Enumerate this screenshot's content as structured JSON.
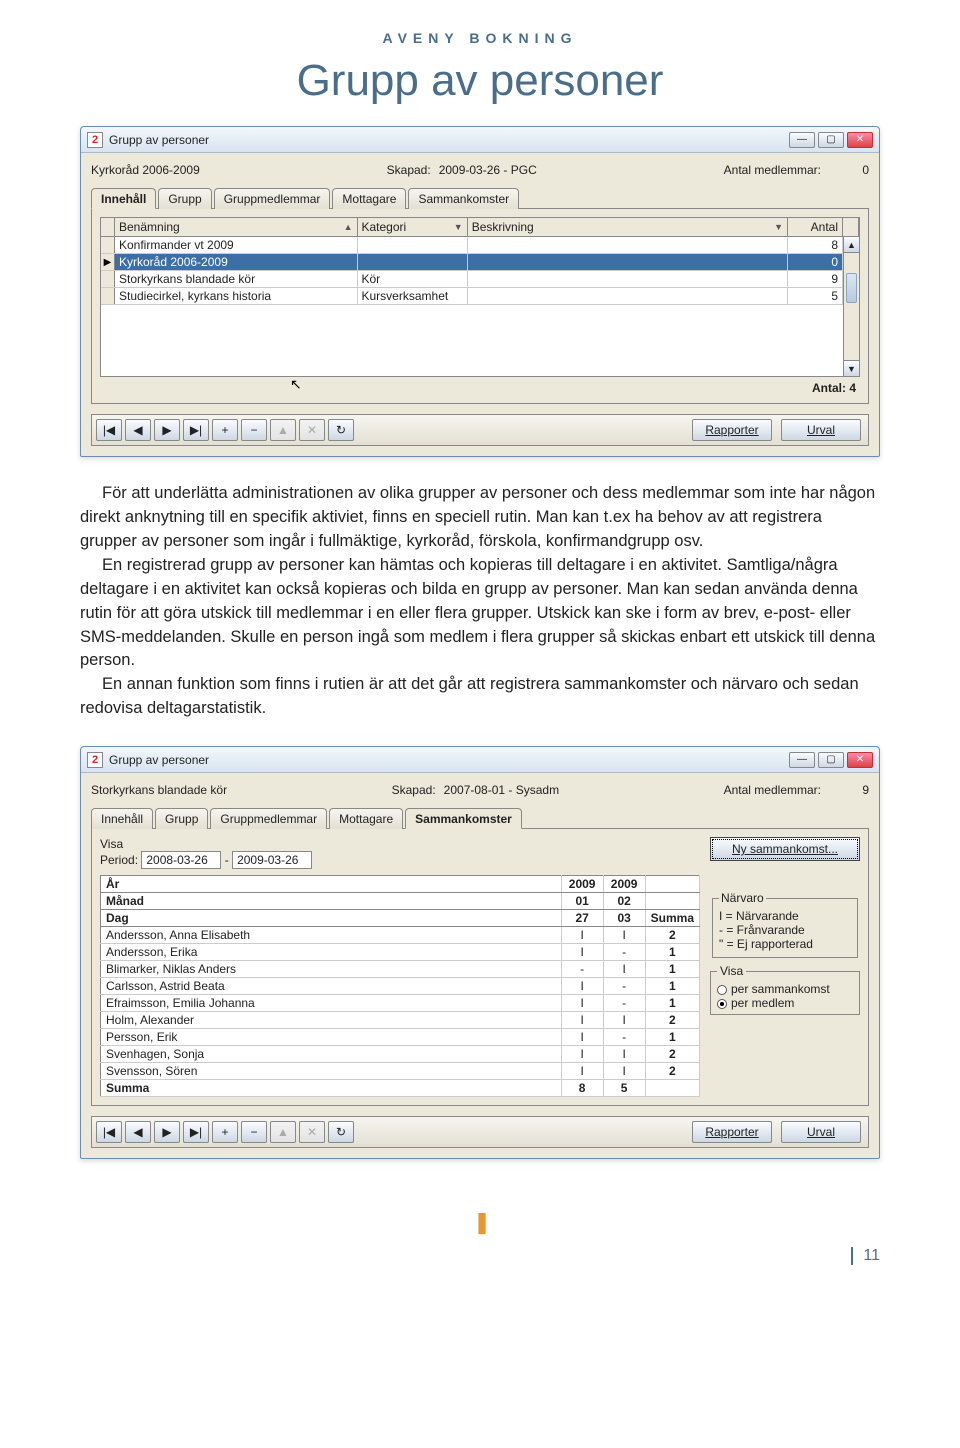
{
  "header": "AVENY BOKNING",
  "page_title": "Grupp av personer",
  "page_number": "11",
  "body_paragraphs": [
    "För att underlätta administrationen av olika grupper av personer och dess medlemmar som inte har någon direkt anknytning till en specifik aktiviet, finns en speciell rutin. Man kan t.ex ha behov av att registrera grupper av personer som ingår i fullmäktige, kyrkoråd, förskola, konfirmandgrupp osv.",
    "En registrerad grupp av personer kan hämtas och kopieras till deltagare i en aktivitet. Samtliga/några deltagare i en aktivitet kan också kopieras och bilda en grupp av personer. Man kan sedan använda denna rutin för att göra utskick till medlemmar i en eller flera grupper. Utskick kan ske i form av brev, e-post- eller SMS-meddelanden. Skulle en person ingå som medlem i flera grupper så skickas enbart ett utskick till denna person.",
    "En annan funktion som finns i rutien är att det går att registrera sammankomster och närvaro och sedan redovisa deltagarstatistik."
  ],
  "window1": {
    "icon": "2",
    "title": "Grupp av personer",
    "name_label": "Kyrkoråd 2006-2009",
    "created_label": "Skapad:",
    "created_value": "2009-03-26 - PGC",
    "members_label": "Antal medlemmar:",
    "members_value": "0",
    "tabs": [
      "Innehåll",
      "Grupp",
      "Gruppmedlemmar",
      "Mottagare",
      "Sammankomster"
    ],
    "active_tab": 0,
    "columns": [
      "Benämning",
      "Kategori",
      "Beskrivning",
      "Antal"
    ],
    "rows": [
      {
        "name": "Konfirmander vt 2009",
        "cat": "",
        "desc": "",
        "count": "8",
        "sel": false,
        "ptr": ""
      },
      {
        "name": "Kyrkoråd 2006-2009",
        "cat": "",
        "desc": "",
        "count": "0",
        "sel": true,
        "ptr": "▶"
      },
      {
        "name": "Storkyrkans blandade kör",
        "cat": "Kör",
        "desc": "",
        "count": "9",
        "sel": false,
        "ptr": ""
      },
      {
        "name": "Studiecirkel, kyrkans historia",
        "cat": "Kursverksamhet",
        "desc": "",
        "count": "5",
        "sel": false,
        "ptr": ""
      }
    ],
    "antal_label": "Antal:",
    "antal_value": "4",
    "nav": [
      "|◀",
      "◀",
      "▶",
      "▶|",
      "+",
      "−",
      "▲",
      "✕",
      "↻"
    ],
    "btn_rapporter": "Rapporter",
    "btn_urval": "Urval"
  },
  "window2": {
    "icon": "2",
    "title": "Grupp av personer",
    "name_label": "Storkyrkans blandade kör",
    "created_label": "Skapad:",
    "created_value": "2007-08-01 - Sysadm",
    "members_label": "Antal medlemmar:",
    "members_value": "9",
    "tabs": [
      "Innehåll",
      "Grupp",
      "Gruppmedlemmar",
      "Mottagare",
      "Sammankomster"
    ],
    "active_tab": 4,
    "visa_label": "Visa",
    "period_label": "Period:",
    "period_from": "2008-03-26",
    "period_to": "2009-03-26",
    "btn_ny": "Ny sammankomst...",
    "header_rows": {
      "ar_label": "År",
      "ar_1": "2009",
      "ar_2": "2009",
      "manad_label": "Månad",
      "manad_1": "01",
      "manad_2": "02",
      "dag_label": "Dag",
      "dag_1": "27",
      "dag_2": "03",
      "summa": "Summa"
    },
    "people": [
      {
        "name": "Andersson, Anna Elisabeth",
        "c1": "I",
        "c2": "I",
        "sum": "2"
      },
      {
        "name": "Andersson, Erika",
        "c1": "I",
        "c2": "-",
        "sum": "1"
      },
      {
        "name": "Blimarker, Niklas Anders",
        "c1": "-",
        "c2": "I",
        "sum": "1"
      },
      {
        "name": "Carlsson, Astrid Beata",
        "c1": "I",
        "c2": "-",
        "sum": "1"
      },
      {
        "name": "Efraimsson, Emilia Johanna",
        "c1": "I",
        "c2": "-",
        "sum": "1"
      },
      {
        "name": "Holm, Alexander",
        "c1": "I",
        "c2": "I",
        "sum": "2"
      },
      {
        "name": "Persson, Erik",
        "c1": "I",
        "c2": "-",
        "sum": "1"
      },
      {
        "name": "Svenhagen, Sonja",
        "c1": "I",
        "c2": "I",
        "sum": "2"
      },
      {
        "name": "Svensson, Sören",
        "c1": "I",
        "c2": "I",
        "sum": "2"
      }
    ],
    "summa_label": "Summa",
    "summa_c1": "8",
    "summa_c2": "5",
    "narvaro_title": "Närvaro",
    "narvaro_lines": [
      "I = Närvarande",
      "- = Frånvarande",
      "\" = Ej rapporterad"
    ],
    "visa_group_title": "Visa",
    "visa_opts": [
      "per sammankomst",
      "per medlem"
    ],
    "visa_checked": 1,
    "nav": [
      "|◀",
      "◀",
      "▶",
      "▶|",
      "+",
      "−",
      "▲",
      "✕",
      "↻"
    ],
    "btn_rapporter": "Rapporter",
    "btn_urval": "Urval"
  }
}
